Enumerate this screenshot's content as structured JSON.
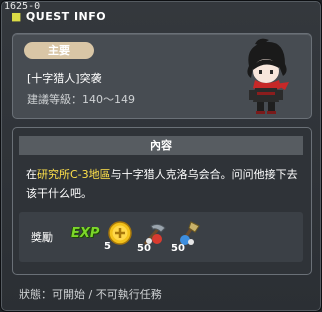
{
  "window": {
    "quest_id": "1625-0",
    "title": "QUEST INFO"
  },
  "quest": {
    "category_badge": "主要",
    "name": "[十字猎人]突袭",
    "level_label": "建議等級：140～149"
  },
  "content": {
    "header": "內容",
    "desc_prefix": "在",
    "desc_highlight": "研究所C-3地區",
    "desc_suffix": "与十字猎人克洛乌会合。问问他接下去该干什么吧。"
  },
  "rewards": {
    "label": "獎勵",
    "items": [
      {
        "icon": "exp-icon",
        "text": "EXP"
      },
      {
        "icon": "coin-icon",
        "count": "5"
      },
      {
        "icon": "pickaxe-item-icon",
        "count": "50"
      },
      {
        "icon": "shovel-item-icon",
        "count": "50"
      }
    ]
  },
  "status": {
    "text": "狀態：可開始 / 不可執行任務"
  },
  "colors": {
    "highlight": "#ffe14a",
    "exp_green": "#7cd62a",
    "badge": "#d9c6a6"
  }
}
